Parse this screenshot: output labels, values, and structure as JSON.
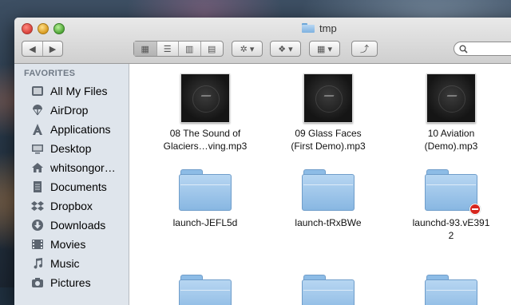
{
  "window": {
    "title": "tmp"
  },
  "toolbar": {
    "back_label": "◀",
    "forward_label": "▶",
    "view_icon_label": "▦",
    "view_list_label": "☰",
    "view_column_label": "▥",
    "view_coverflow_label": "▤",
    "action_label": "✲ ▾",
    "dropbox_label": "❖ ▾",
    "arrange_label": "▦ ▾",
    "share_label": "⤴",
    "search_placeholder": ""
  },
  "sidebar": {
    "heading": "FAVORITES",
    "items": [
      {
        "label": "All My Files",
        "icon": "all-my-files-icon"
      },
      {
        "label": "AirDrop",
        "icon": "airdrop-icon"
      },
      {
        "label": "Applications",
        "icon": "applications-icon"
      },
      {
        "label": "Desktop",
        "icon": "desktop-icon"
      },
      {
        "label": "whitsongor…",
        "icon": "home-icon"
      },
      {
        "label": "Documents",
        "icon": "documents-icon"
      },
      {
        "label": "Dropbox",
        "icon": "dropbox-icon"
      },
      {
        "label": "Downloads",
        "icon": "downloads-icon"
      },
      {
        "label": "Movies",
        "icon": "movies-icon"
      },
      {
        "label": "Music",
        "icon": "music-icon"
      },
      {
        "label": "Pictures",
        "icon": "pictures-icon"
      }
    ]
  },
  "files": [
    {
      "line1": "08 The Sound of",
      "line2": "Glaciers…ving.mp3",
      "kind": "audio"
    },
    {
      "line1": "09 Glass Faces",
      "line2": "(First Demo).mp3",
      "kind": "audio"
    },
    {
      "line1": "10 Aviation",
      "line2": "(Demo).mp3",
      "kind": "audio"
    },
    {
      "line1": "launch-JEFL5d",
      "line2": "",
      "kind": "folder"
    },
    {
      "line1": "launch-tRxBWe",
      "line2": "",
      "kind": "folder"
    },
    {
      "line1": "launchd-93.vE391",
      "line2": "2",
      "kind": "folder",
      "badge": "no-entry"
    }
  ],
  "colors": {
    "sidebar_bg": "#dfe5ec",
    "sidebar_heading": "#707a86",
    "folder_blue": "#88b7e2",
    "badge_red": "#d7261e"
  }
}
